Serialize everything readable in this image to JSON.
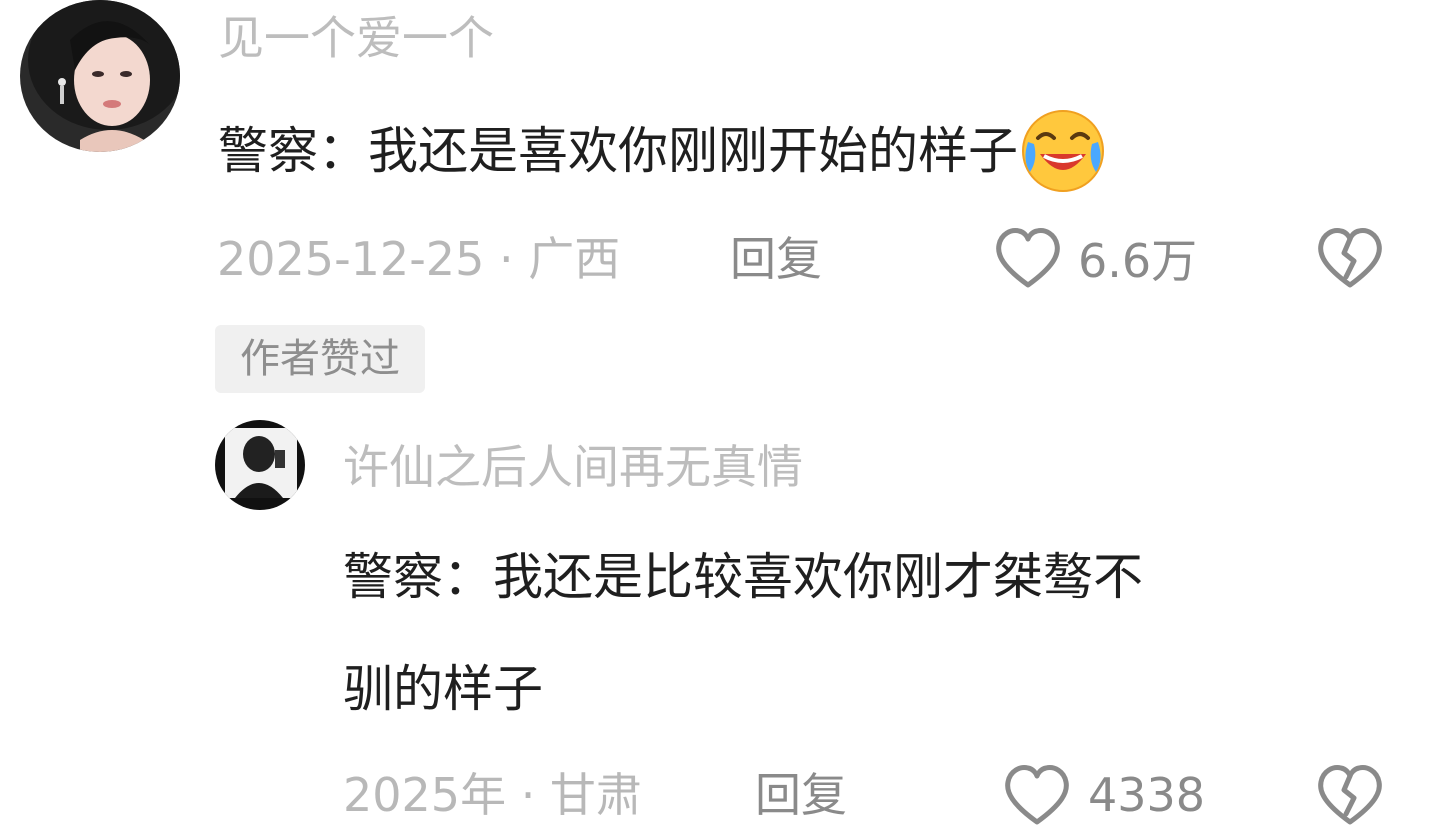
{
  "comment": {
    "username": "见一个爱一个",
    "text": "警察：我还是喜欢你刚刚开始的样子",
    "emoji_icon": "laughing-crying-emoji",
    "date_location": "2025-12-25 · 广西",
    "reply_label": "回复",
    "like_count": "6.6万",
    "author_tag": "作者赞过"
  },
  "reply": {
    "username": "许仙之后人间再无真情",
    "text_line1": "警察：我还是比较喜欢你刚才桀骜不",
    "text_line2": "驯的样子",
    "date_location": "2025年 · 甘肃",
    "reply_label": "回复",
    "like_count": "4338"
  },
  "icons": {
    "like": "heart-outline-icon",
    "dislike": "broken-heart-icon"
  },
  "colors": {
    "username": "#bdbdbd",
    "text": "#1f1f1f",
    "meta": "#b8b8b8",
    "action": "#8a8a8a",
    "tag_bg": "#f0f0f0"
  }
}
